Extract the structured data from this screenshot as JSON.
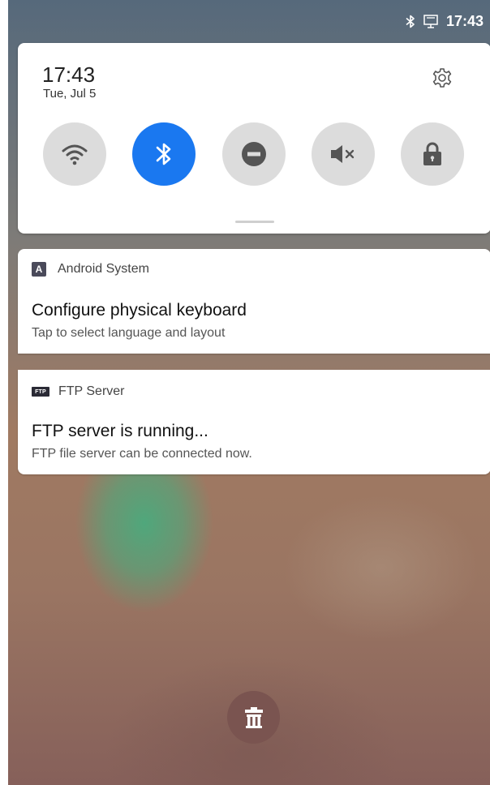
{
  "status_bar": {
    "icons": [
      "bluetooth-icon",
      "ethernet-icon"
    ],
    "time": "17:43"
  },
  "quick_settings": {
    "time": "17:43",
    "date": "Tue, Jul 5",
    "tiles": [
      {
        "name": "wifi",
        "icon": "wifi-icon",
        "active": false
      },
      {
        "name": "bluetooth",
        "icon": "bluetooth-icon",
        "active": true
      },
      {
        "name": "do-not-disturb",
        "icon": "dnd-icon",
        "active": false
      },
      {
        "name": "sound",
        "icon": "mute-icon",
        "active": false
      },
      {
        "name": "screen-lock",
        "icon": "lock-icon",
        "active": false
      }
    ],
    "accent_color": "#1a78f0"
  },
  "notifications": [
    {
      "app_name": "Android System",
      "icon": "android-system-icon",
      "icon_letter": "A",
      "title": "Configure physical keyboard",
      "text": "Tap to select language and layout"
    },
    {
      "app_name": "FTP Server",
      "icon": "ftp-icon",
      "icon_letter": "FTP",
      "title": "FTP server is running...",
      "text": "FTP file server can be connected now."
    }
  ],
  "clear_all": {
    "icon": "trash-icon"
  }
}
